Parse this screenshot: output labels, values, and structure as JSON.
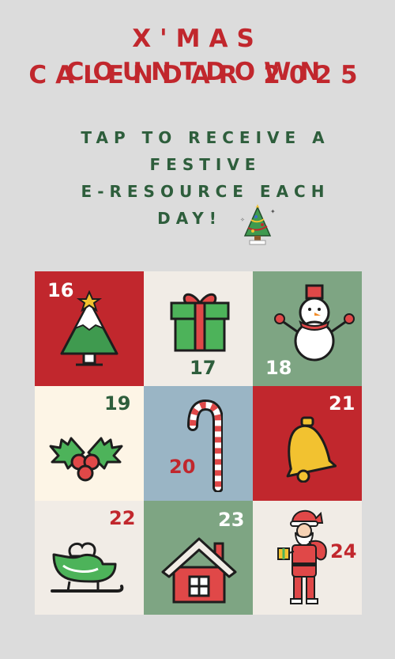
{
  "header": {
    "title_line1": "X'MAS COUNTDOWN",
    "title_line2": "CALENDAR 2025",
    "subtitle_line1": "TAP TO RECEIVE A",
    "subtitle_line2": "FESTIVE",
    "subtitle_line3": "E-RESOURCE EACH",
    "subtitle_line4": "DAY!"
  },
  "colors": {
    "red": "#c1272d",
    "cream": "#f1ece6",
    "sage": "#7ea583",
    "ivory": "#fdf5e6",
    "blue": "#9ab5c5",
    "dark_green": "#2e5e3c"
  },
  "days": [
    {
      "day": "16",
      "icon": "christmas-tree-icon",
      "bg": "#c1272d",
      "num_color": "#ffffff"
    },
    {
      "day": "17",
      "icon": "gift-box-icon",
      "bg": "#f1ece6",
      "num_color": "#2e5e3c"
    },
    {
      "day": "18",
      "icon": "snowman-icon",
      "bg": "#7ea583",
      "num_color": "#ffffff"
    },
    {
      "day": "19",
      "icon": "holly-icon",
      "bg": "#fdf5e6",
      "num_color": "#2e5e3c"
    },
    {
      "day": "20",
      "icon": "candy-cane-icon",
      "bg": "#9ab5c5",
      "num_color": "#c1272d"
    },
    {
      "day": "21",
      "icon": "bell-icon",
      "bg": "#c1272d",
      "num_color": "#ffffff"
    },
    {
      "day": "22",
      "icon": "sleigh-icon",
      "bg": "#f1ece6",
      "num_color": "#c1272d"
    },
    {
      "day": "23",
      "icon": "house-icon",
      "bg": "#7ea583",
      "num_color": "#ffffff"
    },
    {
      "day": "24",
      "icon": "santa-claus-icon",
      "bg": "#f1ece6",
      "num_color": "#c1272d"
    }
  ]
}
